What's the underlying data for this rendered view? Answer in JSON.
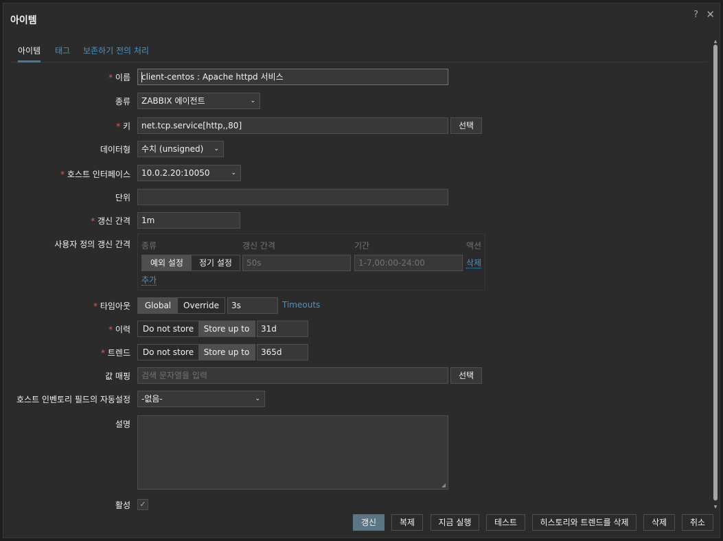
{
  "dialog": {
    "title": "아이템",
    "help_icon": "?",
    "close_icon": "✕"
  },
  "tabs": [
    {
      "label": "아이템",
      "active": true
    },
    {
      "label": "태그",
      "active": false
    },
    {
      "label": "보존하기 전의 처리",
      "active": false
    }
  ],
  "form": {
    "name": {
      "label": "이름",
      "required": true,
      "value": "client-centos : Apache httpd 서비스"
    },
    "type": {
      "label": "종류",
      "value": "ZABBIX 에이전트"
    },
    "key": {
      "label": "키",
      "required": true,
      "value": "net.tcp.service[http,,80]",
      "button": "선택"
    },
    "data_type": {
      "label": "데이터형",
      "value": "수치 (unsigned)"
    },
    "host_interface": {
      "label": "호스트 인터페이스",
      "required": true,
      "value": "10.0.2.20:10050"
    },
    "units": {
      "label": "단위",
      "value": ""
    },
    "update_interval": {
      "label": "갱신 간격",
      "required": true,
      "value": "1m"
    },
    "custom_intervals": {
      "label": "사용자 정의 갱신 간격",
      "headers": {
        "type": "종류",
        "interval": "갱신 간격",
        "period": "기간",
        "action": "액션"
      },
      "seg_flexible": "예외 설정",
      "seg_scheduling": "정기 설정",
      "interval_placeholder": "50s",
      "period_placeholder": "1-7,00:00-24:00",
      "remove": "삭제",
      "add": "추가"
    },
    "timeout": {
      "label": "타임아웃",
      "required": true,
      "seg_global": "Global",
      "seg_override": "Override",
      "value": "3s",
      "link": "Timeouts"
    },
    "history": {
      "label": "이력",
      "required": true,
      "seg_no": "Do not store",
      "seg_store": "Store up to",
      "value": "31d"
    },
    "trends": {
      "label": "트렌드",
      "required": true,
      "seg_no": "Do not store",
      "seg_store": "Store up to",
      "value": "365d"
    },
    "value_mapping": {
      "label": "값 매핑",
      "placeholder": "검색 문자열을 입력",
      "button": "선택"
    },
    "inventory": {
      "label": "호스트 인벤토리 필드의 자동설정",
      "value": "-없음-"
    },
    "description": {
      "label": "설명",
      "value": ""
    },
    "enabled": {
      "label": "활성",
      "checked": true,
      "check_glyph": "✓"
    }
  },
  "footer": {
    "update": "갱신",
    "clone": "복제",
    "execute_now": "지금 실행",
    "test": "테스트",
    "clear_history": "히스토리와 트렌드를 삭제",
    "delete": "삭제",
    "cancel": "취소"
  },
  "required_mark": "*",
  "chevron_glyph": "⌄",
  "colors": {
    "accent": "#5a7583",
    "link": "#4796c4",
    "required": "#e45959",
    "background": "#2b2b2b"
  }
}
